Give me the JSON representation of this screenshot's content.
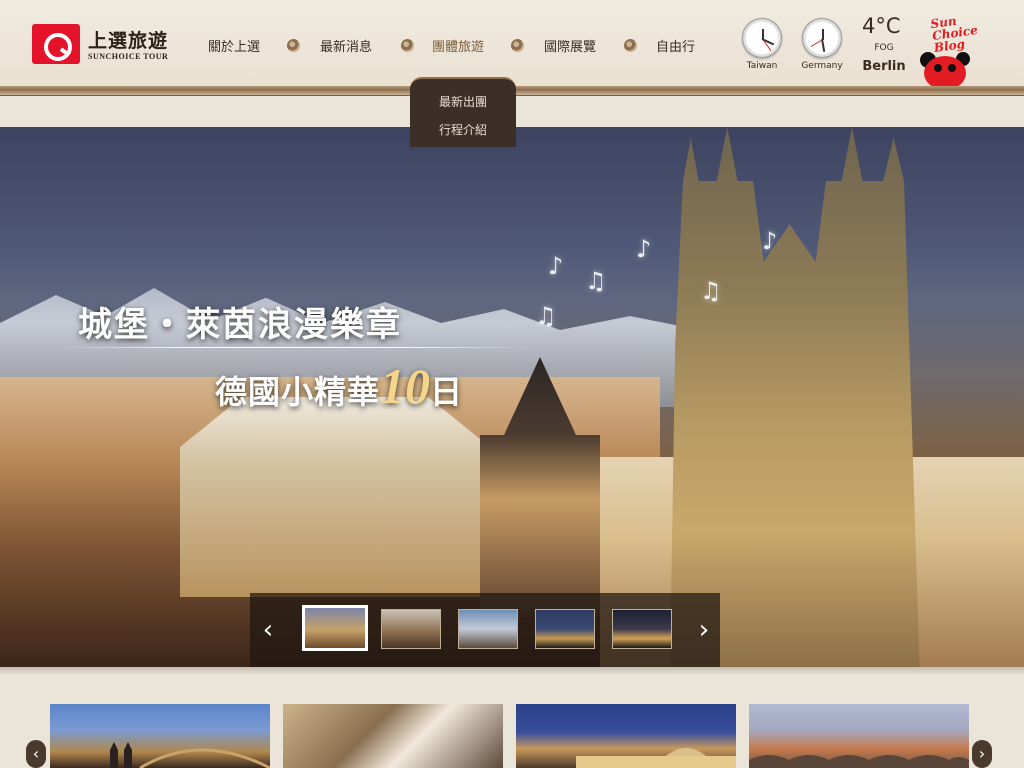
{
  "brand": {
    "name_zh": "上選旅遊",
    "name_en": "SUNCHOICE TOUR",
    "accent_color": "#e4122a"
  },
  "nav": {
    "items": [
      {
        "label": "關於上選",
        "active": false
      },
      {
        "label": "最新消息",
        "active": false
      },
      {
        "label": "團體旅遊",
        "active": true
      },
      {
        "label": "國際展覽",
        "active": false
      },
      {
        "label": "自由行",
        "active": false
      }
    ],
    "dropdown": [
      {
        "label": "最新出團"
      },
      {
        "label": "行程介紹"
      }
    ]
  },
  "clocks": [
    {
      "label": "Taiwan"
    },
    {
      "label": "Germany"
    }
  ],
  "weather": {
    "temp": "4°C",
    "condition": "FOG",
    "city": "Berlin"
  },
  "blog": {
    "text": "Sun Choice Blog",
    "color": "#e31c23"
  },
  "hero": {
    "title": "城堡・萊茵浪漫樂章",
    "subtitle_prefix": "德國小精華",
    "subtitle_number": "10",
    "subtitle_suffix": "日",
    "thumbnails": [
      {
        "name": "prague-old-town",
        "active": true
      },
      {
        "name": "horse-carriage",
        "active": false
      },
      {
        "name": "river-sunset",
        "active": false
      },
      {
        "name": "night-bridge",
        "active": false
      },
      {
        "name": "night-cityscape",
        "active": false
      }
    ],
    "prev_icon": "chevron-left-icon",
    "next_icon": "chevron-right-icon"
  },
  "cards": [
    {
      "name": "cologne-cathedral"
    },
    {
      "name": "beer-pour"
    },
    {
      "name": "london-gallery"
    },
    {
      "name": "charles-bridge"
    }
  ],
  "colors": {
    "header_bg": "#ece5d8",
    "nav_active": "#7a5e3e",
    "dropdown_bg": "#3c2f27"
  }
}
